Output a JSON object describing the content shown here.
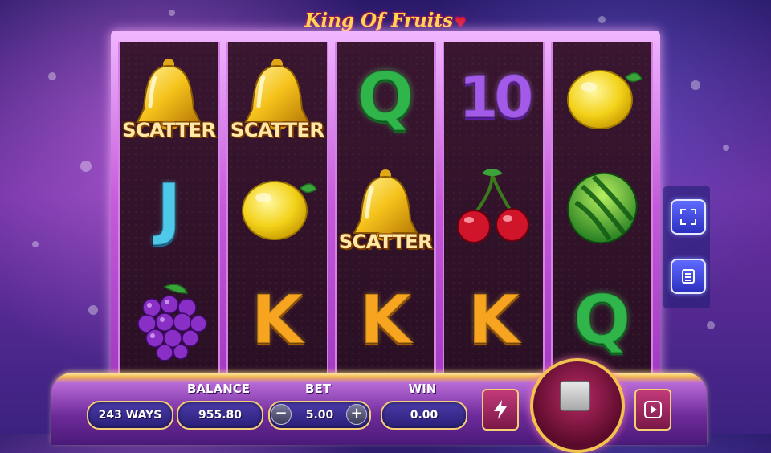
{
  "title": "King Of Fruits",
  "reels": [
    [
      {
        "symbol": "bell",
        "label": "SCATTER"
      },
      {
        "symbol": "J",
        "label": ""
      },
      {
        "symbol": "grapes",
        "label": ""
      }
    ],
    [
      {
        "symbol": "bell",
        "label": "SCATTER"
      },
      {
        "symbol": "lemon",
        "label": ""
      },
      {
        "symbol": "K",
        "label": ""
      }
    ],
    [
      {
        "symbol": "Q",
        "label": ""
      },
      {
        "symbol": "bell",
        "label": "SCATTER"
      },
      {
        "symbol": "K",
        "label": ""
      }
    ],
    [
      {
        "symbol": "10",
        "label": ""
      },
      {
        "symbol": "cherries",
        "label": ""
      },
      {
        "symbol": "K",
        "label": ""
      }
    ],
    [
      {
        "symbol": "lemon",
        "label": ""
      },
      {
        "symbol": "watermelon",
        "label": ""
      },
      {
        "symbol": "Q",
        "label": ""
      }
    ]
  ],
  "bottom": {
    "ways": "243 WAYS",
    "balance_label": "BALANCE",
    "balance_value": "955.80",
    "bet_label": "BET",
    "bet_value": "5.00",
    "win_label": "WIN",
    "win_value": "0.00"
  },
  "icons": {
    "fullscreen": "fullscreen-icon",
    "menu": "menu-icon",
    "turbo": "lightning-icon",
    "autoplay": "autoplay-icon",
    "spin": "stop-icon"
  },
  "colors": {
    "accent_gold": "#f4cf76",
    "frame_pink": "#c55bd9",
    "button_blue": "#3b40d8"
  }
}
